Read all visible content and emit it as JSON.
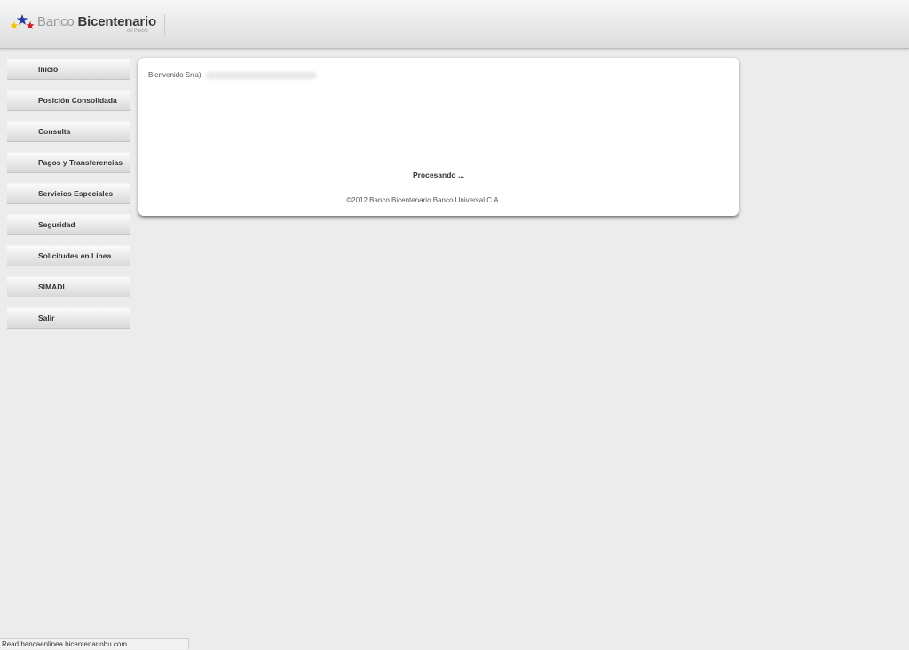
{
  "header": {
    "logo": {
      "brand_light": "Banco",
      "brand_bold": "Bicentenario",
      "tagline": "del Pueblo",
      "star_colors": [
        "#f5c400",
        "#1f3aa6",
        "#d71920"
      ]
    }
  },
  "sidebar": {
    "items": [
      {
        "label": "Inicio"
      },
      {
        "label": "Posición Consolidada"
      },
      {
        "label": "Consulta"
      },
      {
        "label": "Pagos y Transferencias"
      },
      {
        "label": "Servicios Especiales"
      },
      {
        "label": "Seguridad"
      },
      {
        "label": "Solicitudes en Línea"
      },
      {
        "label": "SIMADI"
      },
      {
        "label": "Salir"
      }
    ]
  },
  "main": {
    "welcome_prefix": "Bienvenido Sr(a).",
    "processing": "Procesando ...",
    "copyright": "©2012 Banco Bicentenario Banco Universal C.A."
  },
  "statusbar": {
    "text": "Read bancaenlinea.bicentenariobu.com"
  }
}
